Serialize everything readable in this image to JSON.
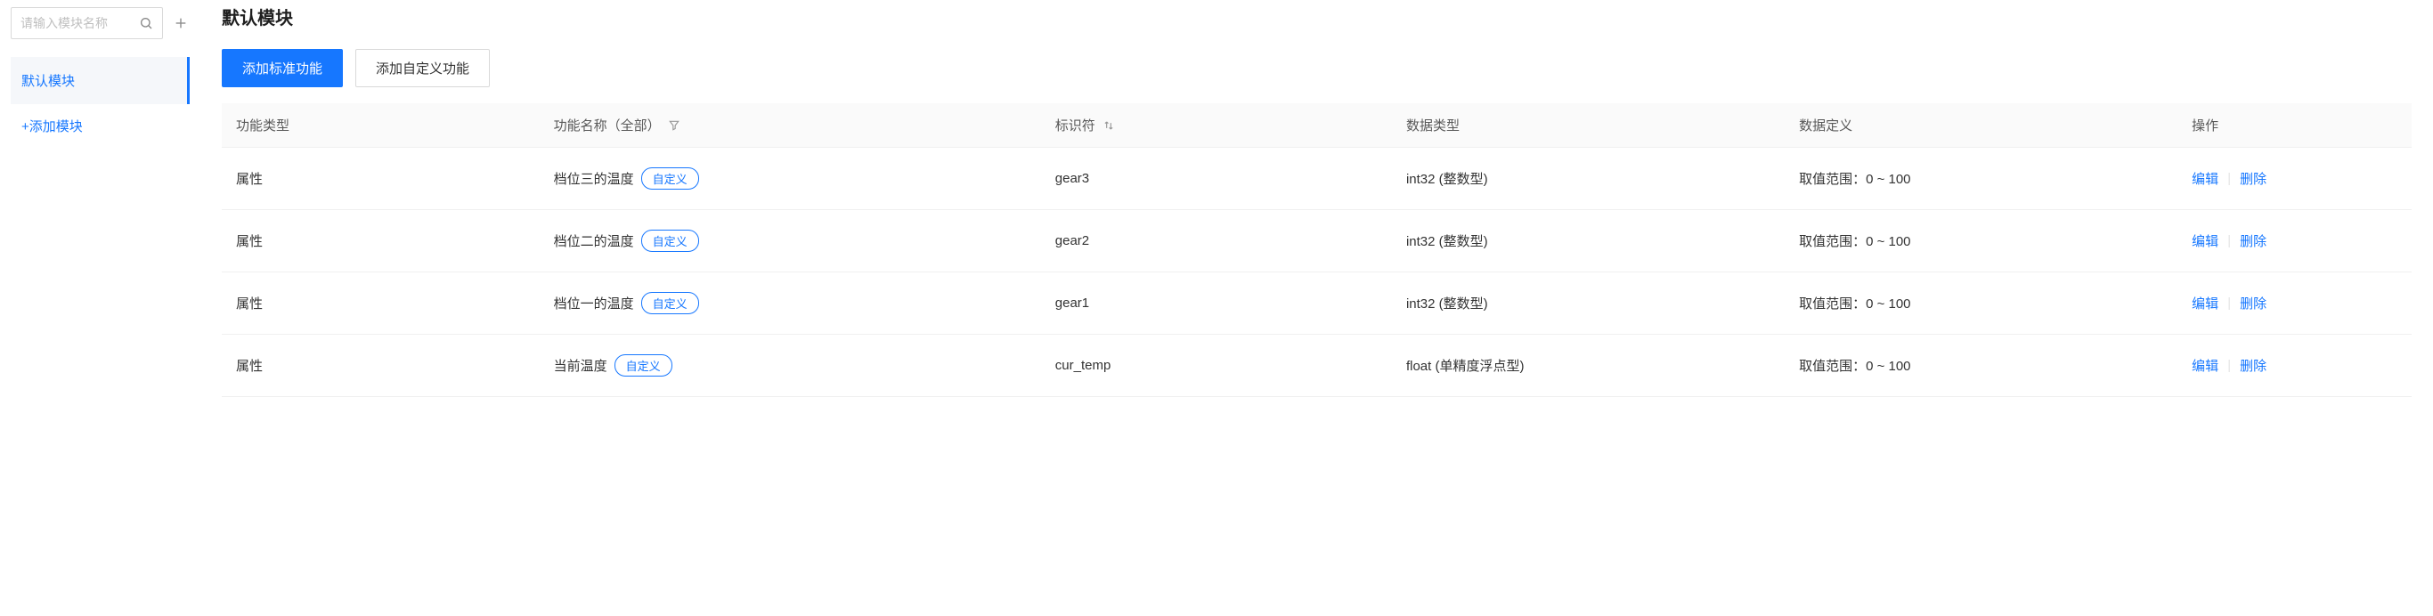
{
  "sidebar": {
    "search_placeholder": "请输入模块名称",
    "modules": [
      {
        "label": "默认模块",
        "active": true
      }
    ],
    "add_module_label": "+添加模块"
  },
  "main": {
    "title": "默认模块",
    "buttons": {
      "add_standard": "添加标准功能",
      "add_custom": "添加自定义功能"
    },
    "table": {
      "headers": {
        "type": "功能类型",
        "name": "功能名称（全部）",
        "identifier": "标识符",
        "data_type": "数据类型",
        "data_def": "数据定义",
        "ops": "操作"
      },
      "custom_tag": "自定义",
      "actions": {
        "edit": "编辑",
        "delete": "删除"
      },
      "rows": [
        {
          "type": "属性",
          "name": "档位三的温度",
          "custom": true,
          "identifier": "gear3",
          "data_type": "int32 (整数型)",
          "data_def": "取值范围：0 ~ 100"
        },
        {
          "type": "属性",
          "name": "档位二的温度",
          "custom": true,
          "identifier": "gear2",
          "data_type": "int32 (整数型)",
          "data_def": "取值范围：0 ~ 100"
        },
        {
          "type": "属性",
          "name": "档位一的温度",
          "custom": true,
          "identifier": "gear1",
          "data_type": "int32 (整数型)",
          "data_def": "取值范围：0 ~ 100"
        },
        {
          "type": "属性",
          "name": "当前温度",
          "custom": true,
          "identifier": "cur_temp",
          "data_type": "float (单精度浮点型)",
          "data_def": "取值范围：0 ~ 100"
        }
      ]
    }
  }
}
